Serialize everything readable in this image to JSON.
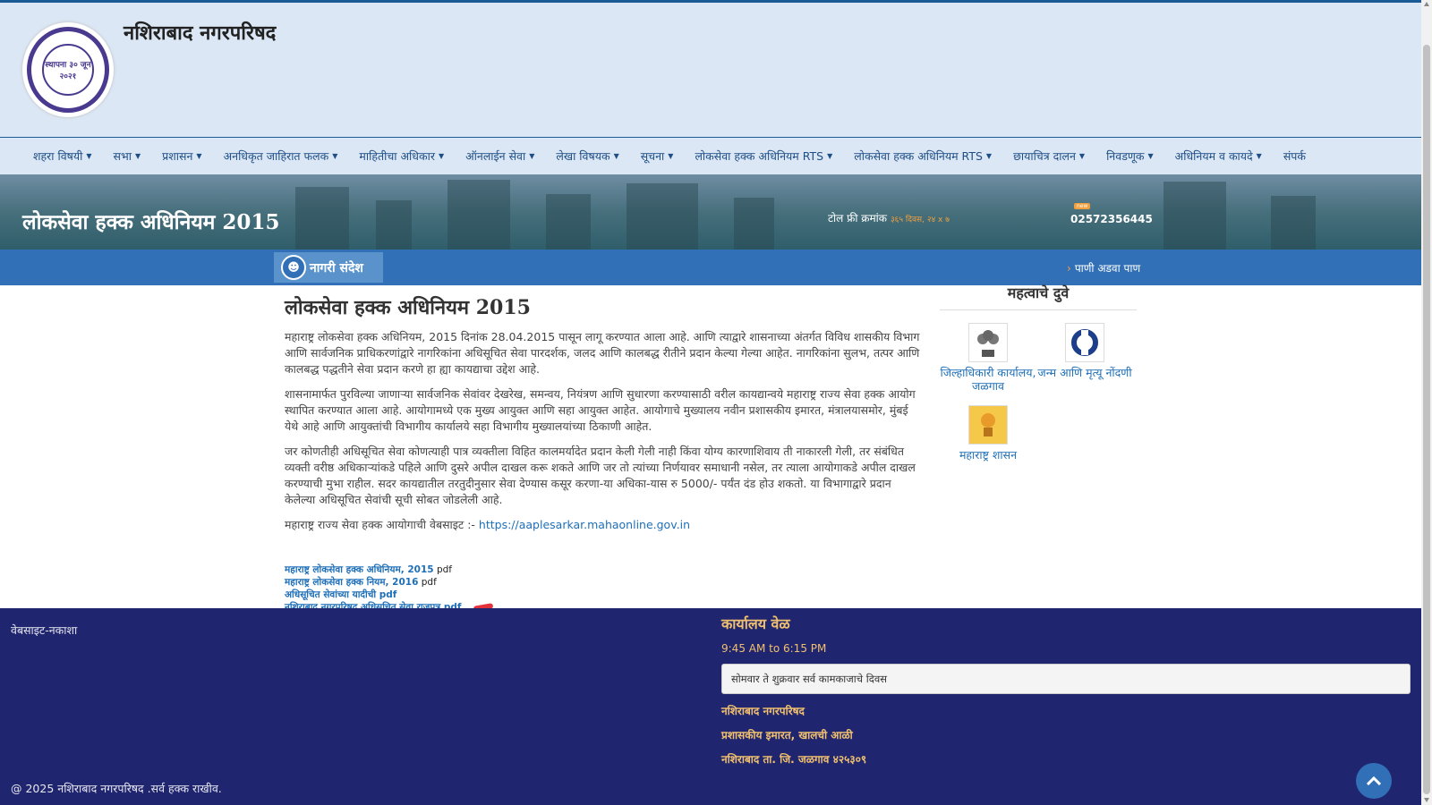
{
  "header": {
    "site_title": "नशिराबाद नगरपरिषद",
    "logo_text": "स्थापना ३० जून २०२१"
  },
  "nav": [
    "शहरा विषयी",
    "सभा",
    "प्रशासन",
    "अनधिकृत जाहिरात फलक",
    "माहितीचा अधिकार",
    "ऑनलाईन सेवा",
    "लेखा विषयक",
    "सूचना",
    "लोकसेवा हक्क अधिनियम RTS",
    "लोकसेवा हक्क अधिनियम RTS",
    "छायाचित्र दालन",
    "निवडणूक",
    "अधिनियम व कायदे",
    "संपर्क"
  ],
  "banner": {
    "title": "लोकसेवा हक्क अधिनियम 2015",
    "tollfree_label": "टोल फ्री क्रमांक",
    "tollfree_sub": "३६५ दिवस, २४ x ७",
    "new_badge": "new",
    "phone": "02572356445"
  },
  "ticker": {
    "label": "नागरी संदेश",
    "text": "पाणी अडवा पाण"
  },
  "content": {
    "heading": "लोकसेवा हक्क अधिनियम 2015",
    "paragraphs": [
      "महाराष्ट्र लोकसेवा हक्क अधिनियम, 2015 दिनांक 28.04.2015 पासून लागू करण्यात आला आहे. आणि त्याद्वारे शासनाच्या अंतर्गत विविध शासकीय विभाग आणि सार्वजनिक प्राधिकरणांद्वारे नागरिकांना अधिसूचित सेवा पारदर्शक, जलद आणि कालबद्ध रीतीने प्रदान केल्या गेल्या आहेत. नागरिकांना सुलभ, तत्पर आणि कालबद्ध पद्धतीने सेवा प्रदान करणे हा ह्या कायद्याचा उद्देश आहे.",
      "शासनामार्फत पुरविल्या जाणाऱ्या सार्वजनिक सेवांवर देखरेख, समन्वय, नियंत्रण आणि सुधारणा करण्यासाठी वरील कायद्यान्वये महाराष्ट्र राज्य सेवा हक्क आयोग स्थापित करण्यात आला आहे. आयोगामध्ये एक मुख्य आयुक्त आणि सहा आयुक्त आहेत. आयोगाचे मुख्यालय नवीन प्रशासकीय इमारत, मंत्रालयासमोर, मुंबई येथे आहे आणि आयुक्तांची विभागीय कार्यालये सहा विभागीय मुख्यालयांच्या ठिकाणी आहेत.",
      "जर कोणतीही अधिसूचित सेवा कोणत्याही पात्र व्यक्तीला विहित कालमर्यादेत प्रदान केली गेली नाही किंवा योग्य कारणाशिवाय ती नाकारली गेली, तर संबंधित व्यक्ती वरीष्ठ अधिकाऱ्यांकडे पहिले आणि दुसरे अपील दाखल करू शकते आणि जर तो त्यांच्या निर्णयावर समाधानी नसेल, तर त्याला आयोगाकडे अपील दाखल करण्याची मुभा राहील. सदर कायद्यातील तरतुदीनुसार सेवा देण्यास कसूर करणा-या अधिका-यास रु 5000/- पर्यंत दंड होउ शकतो. या विभागाद्वारे प्रदान केलेल्या अधिसूचित सेवांची सूची सोबत जोडलेली आहे."
    ],
    "website_label": "महाराष्ट्र राज्य सेवा हक्क आयोगाची वेबसाइट :-",
    "website_url": "https://aaplesarkar.mahaonline.gov.in",
    "pdfs": [
      {
        "link": "महाराष्ट्र लोकसेवा हक्क अधिनियम, 2015",
        "suffix": "pdf"
      },
      {
        "link": "महाराष्ट्र लोकसेवा हक्क नियम, 2016",
        "suffix": "pdf"
      },
      {
        "link": "अधिसूचित सेवांच्या यादीची pdf",
        "suffix": ""
      },
      {
        "link": "नशिराबाद नगरपरिषद अधिसूचित सेवा राजपत्र pdf",
        "suffix": ""
      }
    ]
  },
  "sidebar": {
    "title": "महत्वाचे दुवे",
    "links": [
      {
        "label": "जिल्हाधिकारी कार्यालय, जळगाव",
        "icon": "emblem-icon"
      },
      {
        "label": "जन्म आणि मृत्यू नोंदणी",
        "icon": "birth-death-icon"
      },
      {
        "label": "महाराष्ट्र शासन",
        "icon": "maharashtra-emblem-icon"
      }
    ]
  },
  "footer": {
    "sitemap": "वेबसाइट-नकाशा",
    "copyright": "@ 2025 नशिराबाद नगरपरिषद .सर्व हक्क राखीव.",
    "office_title": "कार्यालय वेळ",
    "office_time": "9:45 AM to 6:15 PM",
    "office_days": "सोमवार ते शुक्रवार सर्व कामकाजाचे दिवस",
    "address": [
      "नशिराबाद नगरपरिषद",
      "प्रशासकीय इमारत, खालची आळी",
      "नशिराबाद ता. जि. जळगाव ४२५३०९"
    ]
  },
  "colors": {
    "nav_bg": "#dbe7f4",
    "ticker_bg": "#3170b6",
    "footer_bg": "#1f256e",
    "link": "#1e6fb8",
    "accent": "#f2a03d"
  }
}
